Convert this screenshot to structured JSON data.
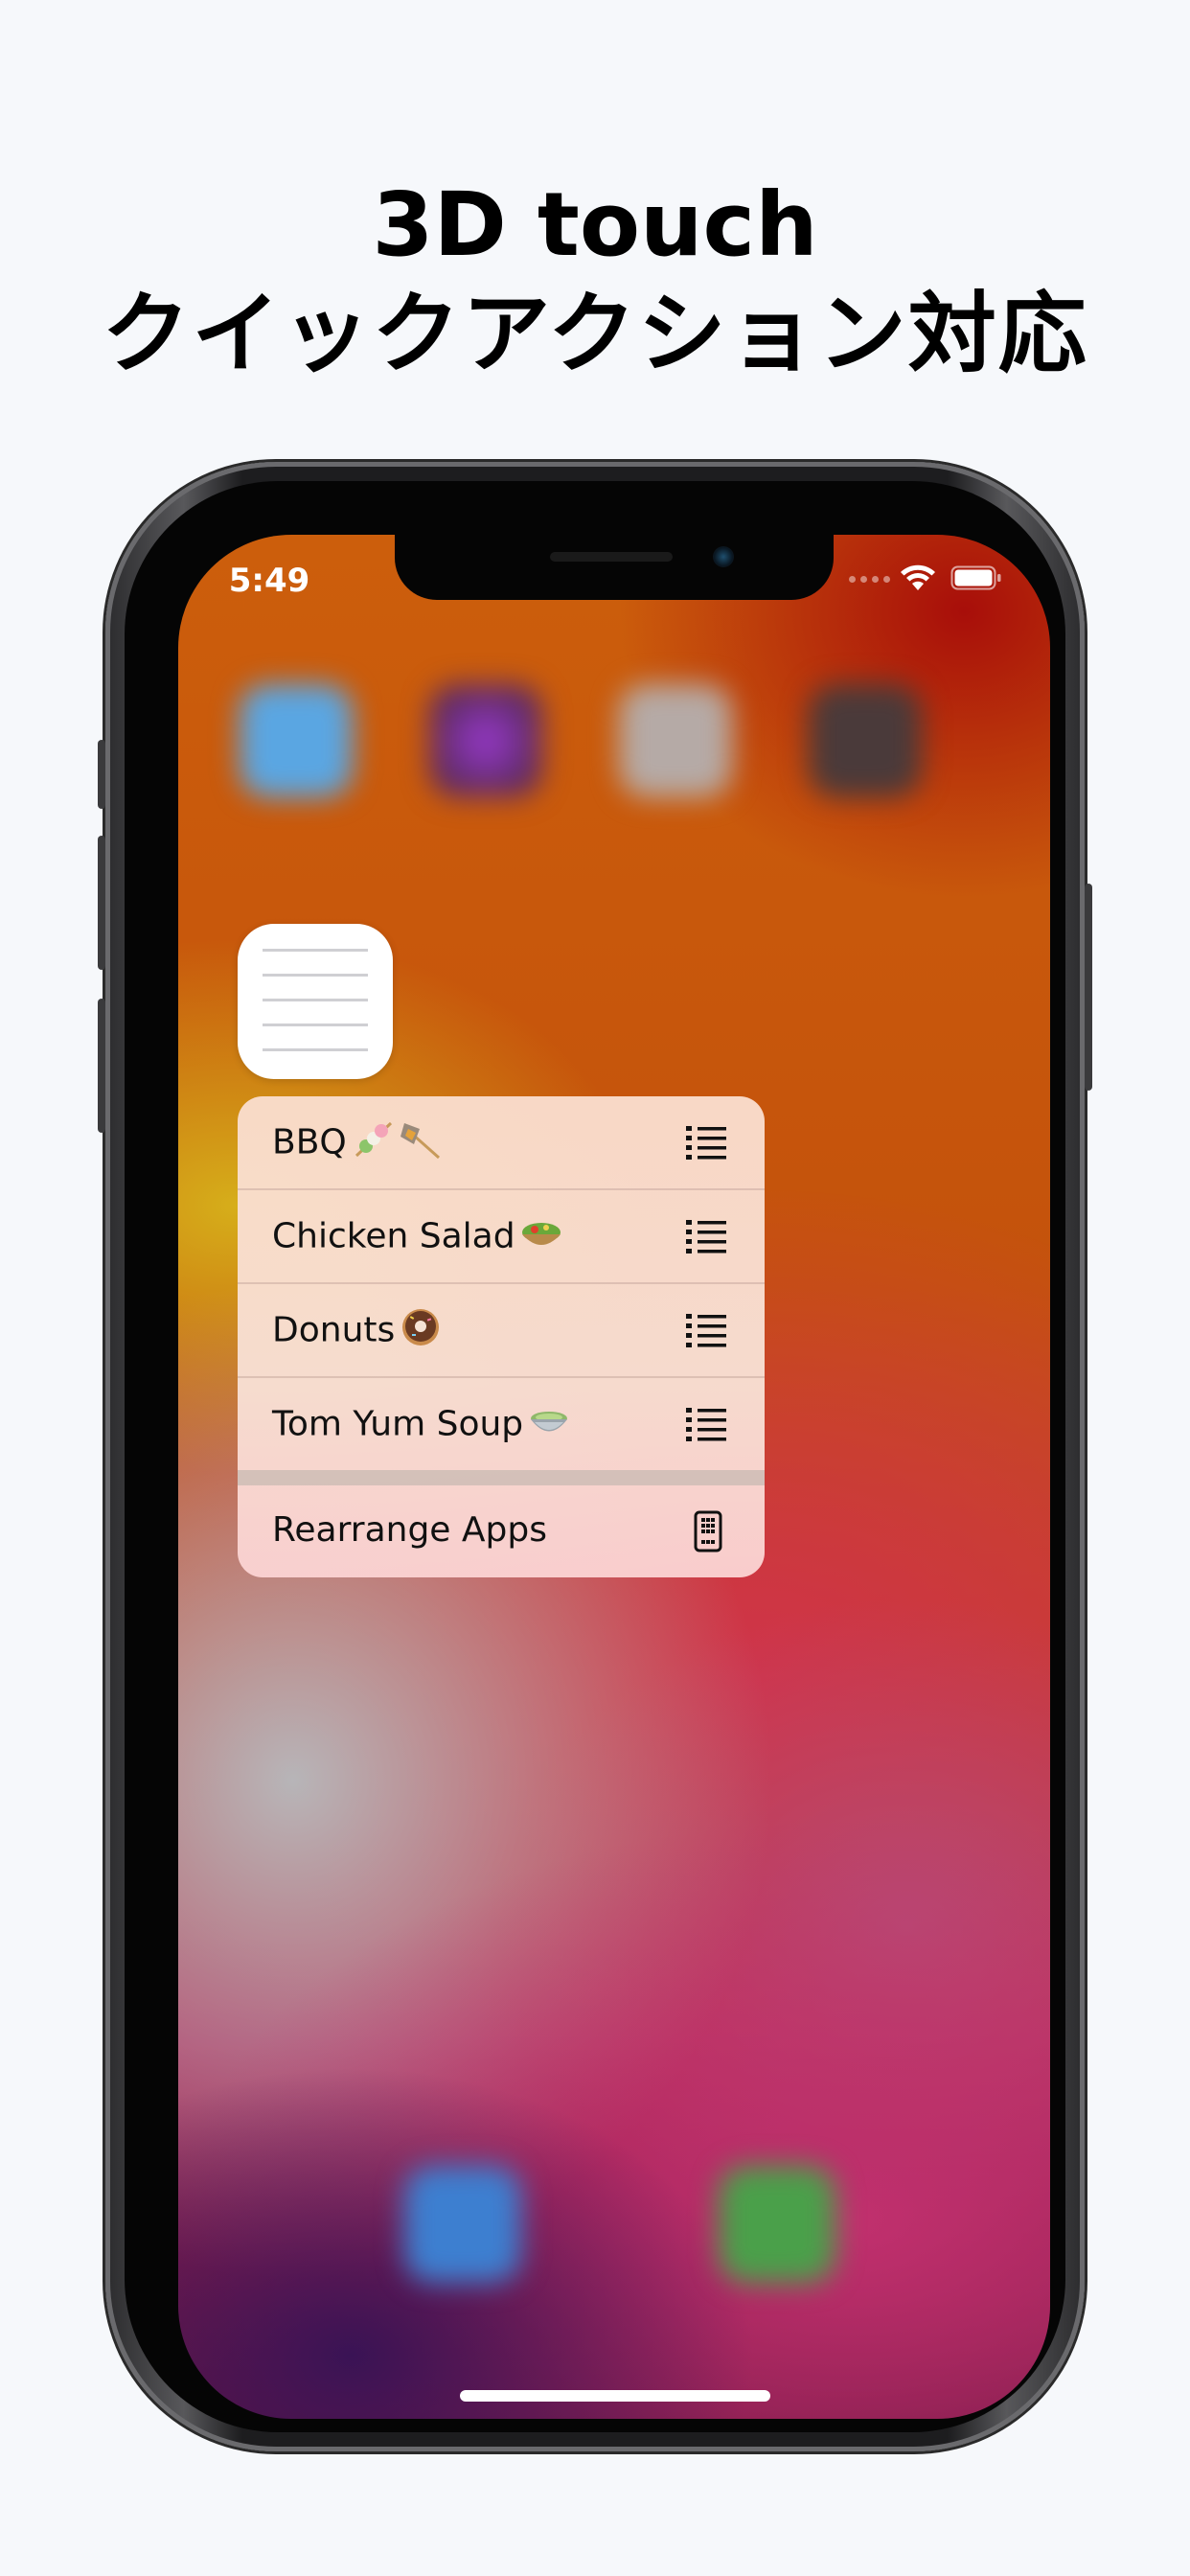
{
  "headline": {
    "line1": "3D touch",
    "line2": "クイックアクション対応"
  },
  "status_bar": {
    "time": "5:49"
  },
  "quick_actions": {
    "items": [
      {
        "label": "BBQ",
        "emoji": "skewer-emoji",
        "icon": "list-icon"
      },
      {
        "label": "Chicken Salad",
        "emoji": "salad-emoji",
        "icon": "list-icon"
      },
      {
        "label": "Donuts",
        "emoji": "donut-emoji",
        "icon": "list-icon"
      },
      {
        "label": "Tom Yum Soup",
        "emoji": "soup-emoji",
        "icon": "list-icon"
      }
    ],
    "rearrange": {
      "label": "Rearrange Apps",
      "icon": "phone-grid-icon"
    }
  },
  "colors": {
    "page_background": "#f6f8fb",
    "menu_background": "#f9dccd",
    "text": "#111111"
  }
}
